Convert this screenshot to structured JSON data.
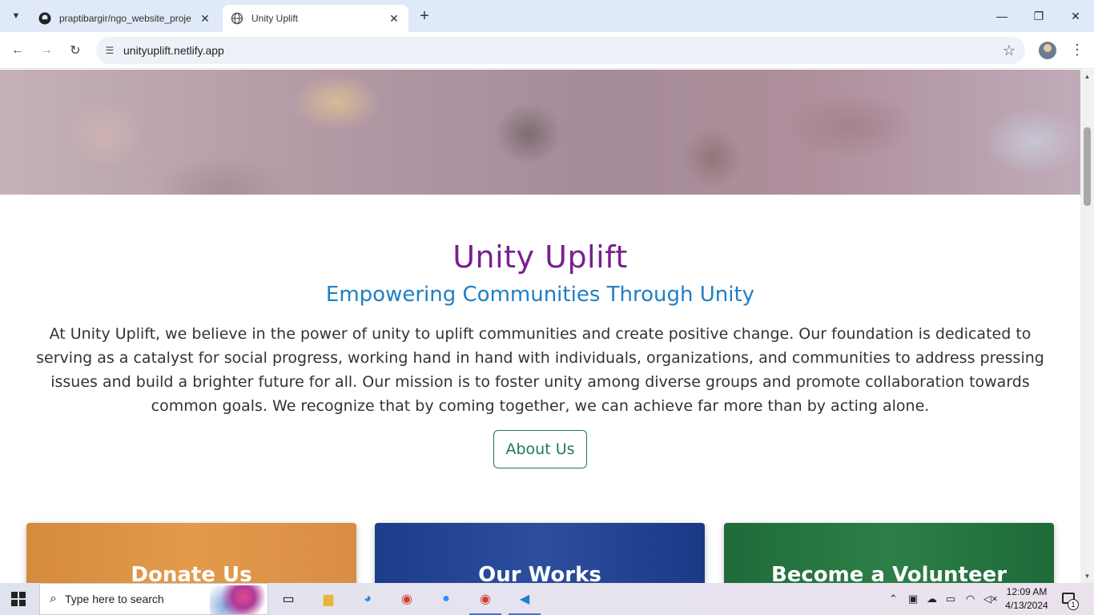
{
  "browser": {
    "tabs": [
      {
        "title": "praptibargir/ngo_website_proje",
        "active": false
      },
      {
        "title": "Unity Uplift",
        "active": true
      }
    ],
    "url": "unityuplift.netlify.app"
  },
  "page": {
    "title": "Unity Uplift",
    "subtitle": "Empowering Communities Through Unity",
    "description": "At Unity Uplift, we believe in the power of unity to uplift communities and create positive change. Our foundation is dedicated to serving as a catalyst for social progress, working hand in hand with individuals, organizations, and communities to address pressing issues and build a brighter future for all. Our mission is to foster unity among diverse groups and promote collaboration towards common goals. We recognize that by coming together, we can achieve far more than by acting alone.",
    "about_button": "About Us",
    "cards": [
      {
        "label": "Donate Us"
      },
      {
        "label": "Our Works"
      },
      {
        "label": "Become a Volunteer"
      }
    ],
    "colors": {
      "title": "#7b1f8f",
      "subtitle": "#1f7fc4",
      "button_accent": "#1f7a55"
    }
  },
  "taskbar": {
    "search_placeholder": "Type here to search",
    "time": "12:09 AM",
    "date": "4/13/2024",
    "notification_count": "1"
  }
}
